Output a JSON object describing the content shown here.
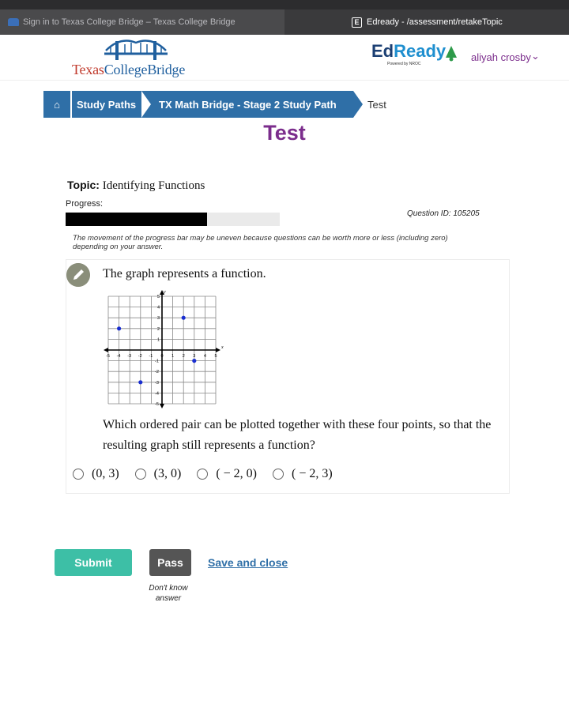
{
  "browser": {
    "tabs": [
      {
        "label": "Sign in to Texas College Bridge – Texas College Bridge",
        "active": false
      },
      {
        "label": "Edready - /assessment/retakeTopic",
        "active": true
      }
    ],
    "close_glyph": "×",
    "edready_tab_glyph": "E"
  },
  "header": {
    "brand_part1": "Texas",
    "brand_part2": "CollegeBridge",
    "edready_part1": "Ed",
    "edready_part2": "Ready",
    "powered_by": "Powered by NROC",
    "user_name": "aliyah crosby",
    "user_chevron": "⌄"
  },
  "breadcrumb": {
    "home_glyph": "⌂",
    "items": [
      "Study Paths",
      "TX Math Bridge - Stage 2 Study Path"
    ],
    "current": "Test"
  },
  "page_title": "Test",
  "topic": {
    "label": "Topic:",
    "value": "Identifying Functions"
  },
  "progress": {
    "label": "Progress:",
    "fraction": 0.66
  },
  "question_id": "Question ID: 105205",
  "progress_note": "The movement of the progress bar may be uneven because questions can be worth more or less (including zero) depending on your answer.",
  "question": {
    "statement": "The graph represents a function.",
    "prompt": "Which ordered pair can be plotted together with these four points, so that the resulting graph still represents a function?",
    "graph": {
      "x_axis_label": "x",
      "y_axis_label": "y",
      "x_range": [
        -5,
        5
      ],
      "y_range": [
        -5,
        5
      ],
      "x_ticks": [
        "-5",
        "-4",
        "-3",
        "-2",
        "-1",
        "0",
        "1",
        "2",
        "3",
        "4",
        "5"
      ],
      "y_ticks": [
        "5",
        "4",
        "3",
        "2",
        "1",
        "-1",
        "-2",
        "-3",
        "-4",
        "-5"
      ],
      "points": [
        [
          -4,
          2
        ],
        [
          -2,
          -3
        ],
        [
          2,
          3
        ],
        [
          3,
          -1
        ]
      ],
      "point_color": "#1a2fd0"
    },
    "choices": [
      "(0, 3)",
      "(3, 0)",
      "( − 2, 0)",
      "( − 2, 3)"
    ]
  },
  "actions": {
    "submit": "Submit",
    "pass": "Pass",
    "save_close": "Save and close",
    "pass_hint": "Don't know answer"
  },
  "colors": {
    "breadcrumb_blue": "#2f6fa7",
    "title_purple": "#7b2d8c",
    "submit_teal": "#3dbfa6",
    "pass_gray": "#555555"
  }
}
